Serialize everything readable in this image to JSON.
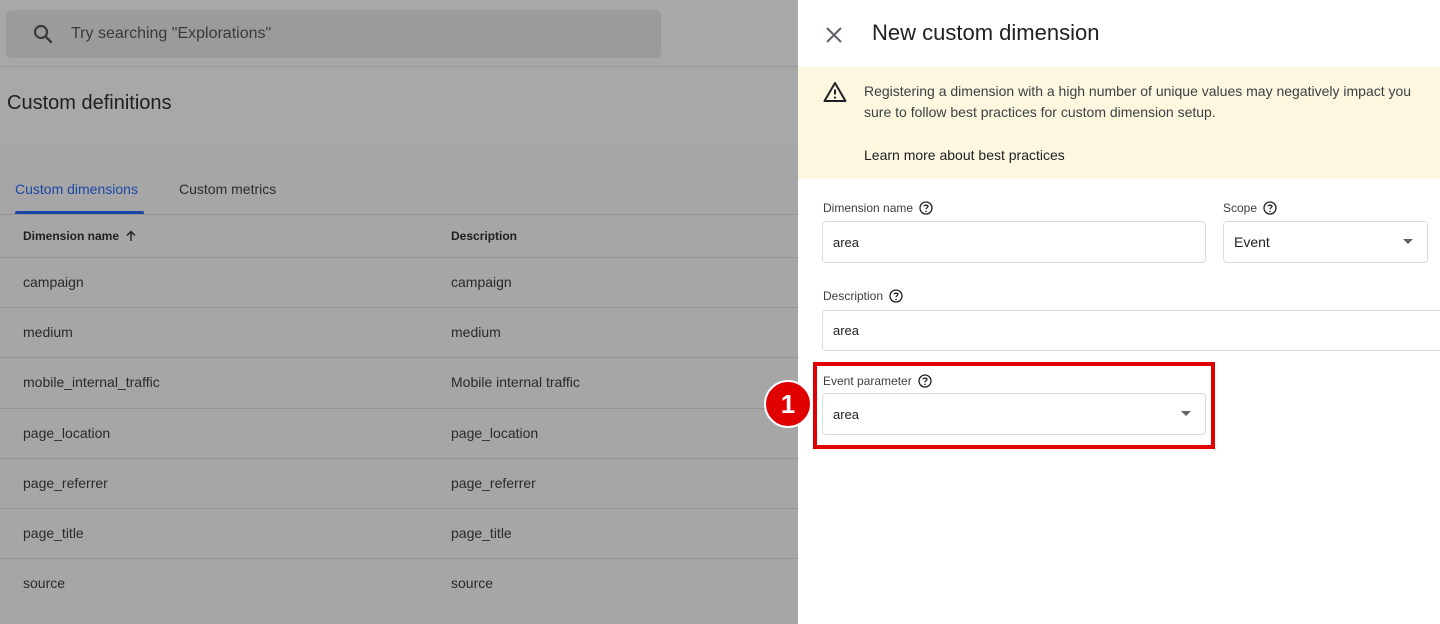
{
  "search": {
    "placeholder": "Try searching \"Explorations\""
  },
  "page": {
    "title": "Custom definitions"
  },
  "tabs": [
    {
      "label": "Custom dimensions",
      "active": true
    },
    {
      "label": "Custom metrics",
      "active": false
    }
  ],
  "table": {
    "columns": [
      "Dimension name",
      "Description"
    ],
    "rows": [
      [
        "campaign",
        "campaign"
      ],
      [
        "medium",
        "medium"
      ],
      [
        "mobile_internal_traffic",
        "Mobile internal traffic"
      ],
      [
        "page_location",
        "page_location"
      ],
      [
        "page_referrer",
        "page_referrer"
      ],
      [
        "page_title",
        "page_title"
      ],
      [
        "source",
        "source"
      ]
    ]
  },
  "panel": {
    "title": "New custom dimension",
    "warning": {
      "line1": "Registering a dimension with a high number of unique values may negatively impact you",
      "line2": "sure to follow best practices for custom dimension setup.",
      "link": "Learn more about best practices"
    },
    "fields": {
      "dimension_name": {
        "label": "Dimension name",
        "value": "area"
      },
      "scope": {
        "label": "Scope",
        "value": "Event"
      },
      "description": {
        "label": "Description",
        "value": "area"
      },
      "event_parameter": {
        "label": "Event parameter",
        "value": "area"
      }
    }
  },
  "annotation": {
    "step": "1"
  },
  "colors": {
    "accent": "#1a47a6",
    "highlight": "#e00000",
    "warning_bg": "#fef7e0"
  }
}
